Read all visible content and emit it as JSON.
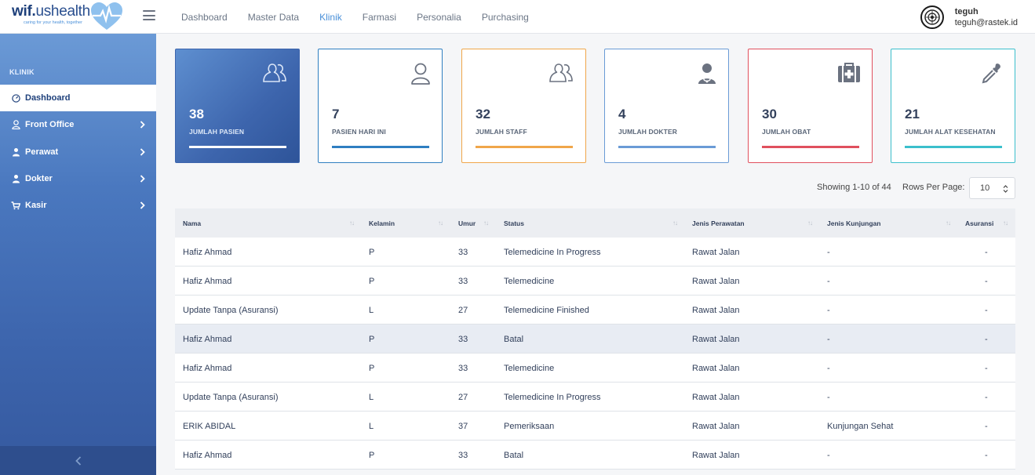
{
  "logo": {
    "brand_bold": "wif.",
    "brand_light": "ushealth",
    "tagline": "caring for your health, together"
  },
  "nav": [
    {
      "label": "Dashboard"
    },
    {
      "label": "Master Data"
    },
    {
      "label": "Klinik",
      "active": true
    },
    {
      "label": "Farmasi"
    },
    {
      "label": "Personalia"
    },
    {
      "label": "Purchasing"
    }
  ],
  "user": {
    "name": "teguh",
    "email": "teguh@rastek.id"
  },
  "sidebar": {
    "section": "KLINIK",
    "items": [
      {
        "label": "Dashboard",
        "icon": "gauge-icon",
        "active": true
      },
      {
        "label": "Front Office",
        "icon": "user-icon"
      },
      {
        "label": "Perawat",
        "icon": "nurse-icon"
      },
      {
        "label": "Dokter",
        "icon": "doctor-icon"
      },
      {
        "label": "Kasir",
        "icon": "cart-icon"
      }
    ]
  },
  "cards": [
    {
      "value": "38",
      "label": "JUMLAH PASIEN",
      "icon": "users-icon",
      "color": "#ffffff"
    },
    {
      "value": "7",
      "label": "PASIEN HARI INI",
      "icon": "user-icon",
      "color": "#2f7fc1"
    },
    {
      "value": "32",
      "label": "JUMLAH STAFF",
      "icon": "users-icon",
      "color": "#f0a64a"
    },
    {
      "value": "4",
      "label": "JUMLAH DOKTER",
      "icon": "doctor-icon",
      "color": "#6a9bd6"
    },
    {
      "value": "30",
      "label": "JUMLAH OBAT",
      "icon": "medkit-icon",
      "color": "#e0505e"
    },
    {
      "value": "21",
      "label": "JUMLAH ALAT KESEHATAN",
      "icon": "eyedropper-icon",
      "color": "#3bbfcc"
    }
  ],
  "table_controls": {
    "showing": "Showing 1-10 of 44",
    "rows_label": "Rows Per Page:",
    "rows_value": "10"
  },
  "table": {
    "columns": [
      "Nama",
      "Kelamin",
      "Umur",
      "Status",
      "Jenis Perawatan",
      "Jenis Kunjungan",
      "Asuransi"
    ],
    "rows": [
      [
        "Hafiz Ahmad",
        "P",
        "33",
        "Telemedicine In Progress",
        "Rawat Jalan",
        "-",
        "-"
      ],
      [
        "Hafiz Ahmad",
        "P",
        "33",
        "Telemedicine",
        "Rawat Jalan",
        "-",
        "-"
      ],
      [
        "Update Tanpa (Asuransi)",
        "L",
        "27",
        "Telemedicine Finished",
        "Rawat Jalan",
        "-",
        "-"
      ],
      [
        "Hafiz Ahmad",
        "P",
        "33",
        "Batal",
        "Rawat Jalan",
        "-",
        "-"
      ],
      [
        "Hafiz Ahmad",
        "P",
        "33",
        "Telemedicine",
        "Rawat Jalan",
        "-",
        "-"
      ],
      [
        "Update Tanpa (Asuransi)",
        "L",
        "27",
        "Telemedicine In Progress",
        "Rawat Jalan",
        "-",
        "-"
      ],
      [
        "ERIK ABIDAL",
        "L",
        "37",
        "Pemeriksaan",
        "Rawat Jalan",
        "Kunjungan Sehat",
        "-"
      ],
      [
        "Hafiz Ahmad",
        "P",
        "33",
        "Batal",
        "Rawat Jalan",
        "-",
        "-"
      ]
    ]
  }
}
